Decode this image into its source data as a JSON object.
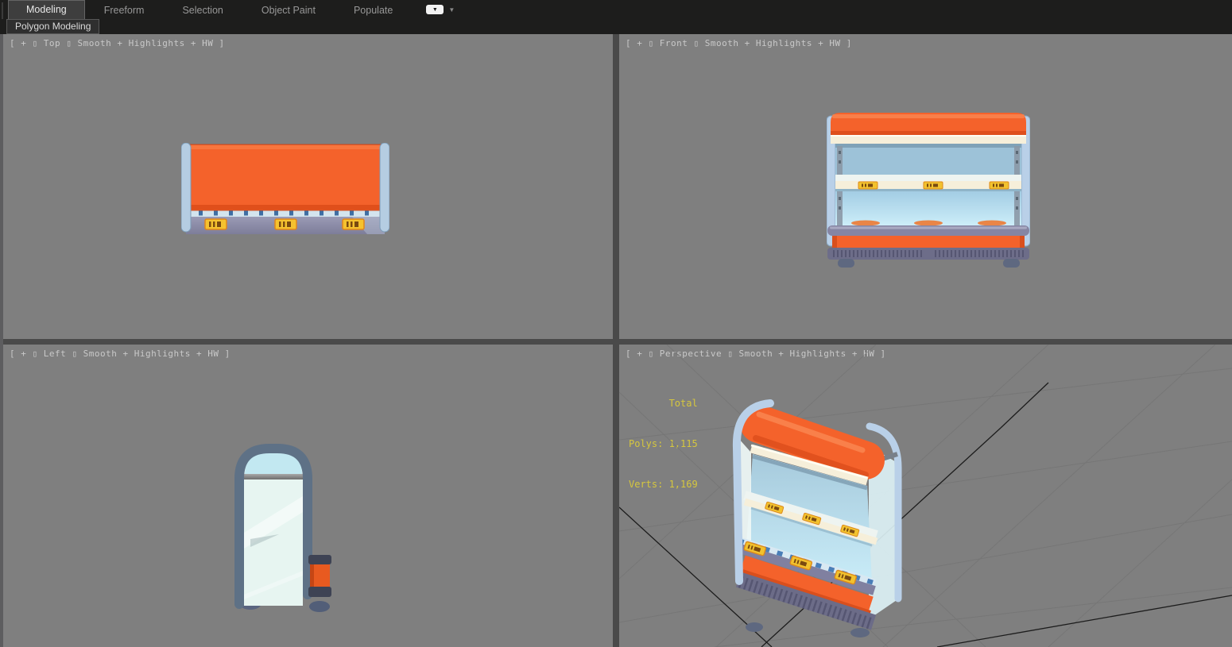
{
  "ribbon": {
    "tabs": [
      {
        "label": "Modeling",
        "active": true
      },
      {
        "label": "Freeform",
        "active": false
      },
      {
        "label": "Selection",
        "active": false
      },
      {
        "label": "Object Paint",
        "active": false
      },
      {
        "label": "Populate",
        "active": false
      }
    ],
    "panel_tab_label": "Polygon Modeling",
    "icons": {
      "ribbon_toggle": "▼",
      "ribbon_caret": "▼"
    }
  },
  "viewports": {
    "top": {
      "label": "[ + ▯ Top ▯ Smooth + Highlights + HW ]"
    },
    "front": {
      "label": "[ + ▯ Front ▯ Smooth + Highlights + HW ]"
    },
    "left": {
      "label": "[ + ▯ Left ▯ Smooth + Highlights + HW ]"
    },
    "perspective": {
      "label": "[ + ▯ Perspective ▯ Smooth + Highlights + HW ]",
      "stats": {
        "total_line": "       Total",
        "polys_line": "Polys: 1,115",
        "verts_line": "Verts: 1,169"
      }
    }
  },
  "colors": {
    "accent_orange": "#f4622b",
    "frame_blue": "#b9d0e8",
    "base_violet": "#6c6c88",
    "tag_yellow": "#f2c22e",
    "stats_yellow": "#d6c73e",
    "viewport_bg": "#7f7f7f",
    "divider": "#4a4a4a"
  }
}
